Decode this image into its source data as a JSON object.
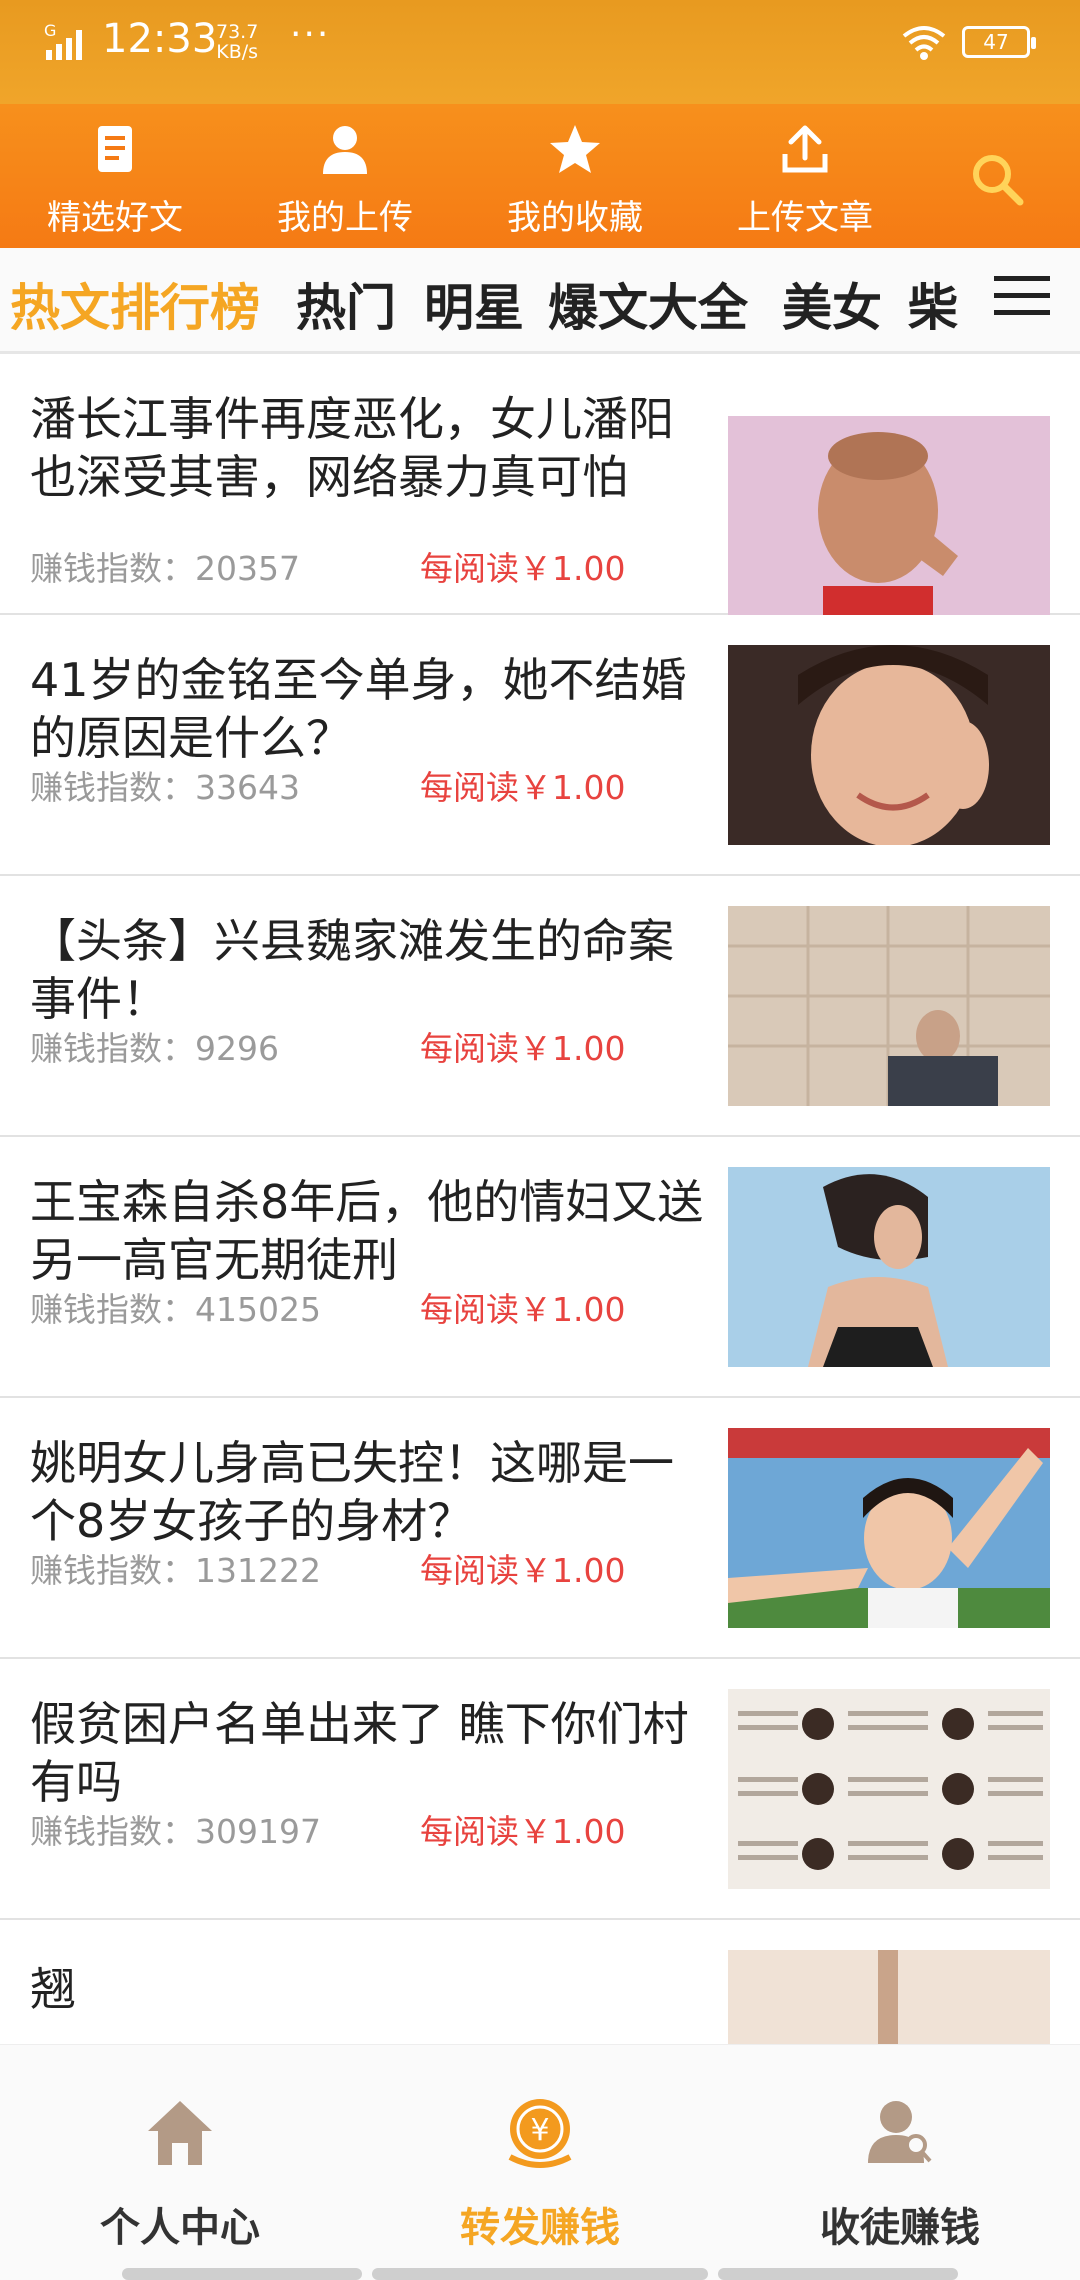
{
  "status": {
    "signal_label": "G",
    "time": "12:33",
    "speed_value": "73.7",
    "speed_unit": "KB/s",
    "dots": "···",
    "battery": "47"
  },
  "top_nav": [
    {
      "label": "精选好文",
      "icon": "article-icon"
    },
    {
      "label": "我的上传",
      "icon": "user-icon"
    },
    {
      "label": "我的收藏",
      "icon": "star-icon"
    },
    {
      "label": "上传文章",
      "icon": "upload-icon"
    }
  ],
  "categories": [
    {
      "label": "热文排行榜",
      "active": true
    },
    {
      "label": "热门",
      "active": false
    },
    {
      "label": "明星",
      "active": false
    },
    {
      "label": "爆文大全",
      "active": false
    },
    {
      "label": "美女",
      "active": false
    },
    {
      "label": "柴",
      "active": false
    }
  ],
  "articles": [
    {
      "title": "潘长江事件再度恶化，女儿潘阳也深受其害，网络暴力真可怕",
      "meta_label": "赚钱指数：",
      "meta_value": "20357",
      "price": "每阅读￥1.00"
    },
    {
      "title": "41岁的金铭至今单身，她不结婚的原因是什么？",
      "meta_label": "赚钱指数：",
      "meta_value": "33643",
      "price": "每阅读￥1.00"
    },
    {
      "title": "【头条】兴县魏家滩发生的命案事件！",
      "meta_label": "赚钱指数：",
      "meta_value": "9296",
      "price": "每阅读￥1.00"
    },
    {
      "title": "王宝森自杀8年后，他的情妇又送另一高官无期徒刑",
      "meta_label": "赚钱指数：",
      "meta_value": "415025",
      "price": "每阅读￥1.00"
    },
    {
      "title": "姚明女儿身高已失控！这哪是一个8岁女孩子的身材？",
      "meta_label": "赚钱指数：",
      "meta_value": "131222",
      "price": "每阅读￥1.00"
    },
    {
      "title": "假贫困户名单出来了 瞧下你们村有吗",
      "meta_label": "赚钱指数：",
      "meta_value": "309197",
      "price": "每阅读￥1.00"
    },
    {
      "title": "翘",
      "meta_label": "",
      "meta_value": "",
      "price": ""
    }
  ],
  "bottom_tabs": [
    {
      "label": "个人中心",
      "icon": "home-icon",
      "active": false
    },
    {
      "label": "转发赚钱",
      "icon": "yuan-coin-icon",
      "active": true
    },
    {
      "label": "收徒赚钱",
      "icon": "user-search-icon",
      "active": false
    }
  ],
  "colors": {
    "header_orange": "#f57a14",
    "active_yellow": "#f5a623",
    "price_red": "#e8433f",
    "meta_gray": "#9a9a9a"
  }
}
